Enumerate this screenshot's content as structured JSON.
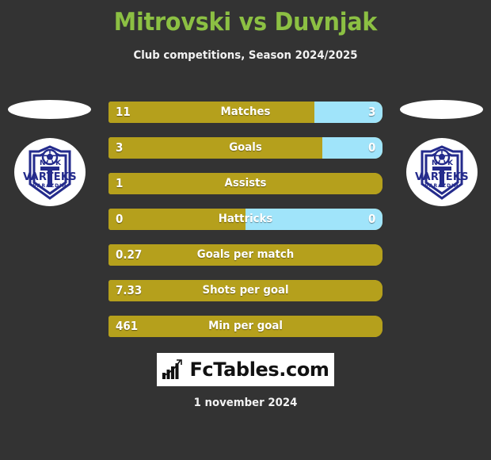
{
  "header": {
    "title": "Mitrovski vs Duvnjak",
    "subtitle": "Club competitions, Season 2024/2025",
    "title_color": "#8CC043"
  },
  "teams": {
    "home": {
      "logo_name": "nk-varteks-varazdin-logo",
      "logo_text_top": "NK",
      "logo_text_main": "VARTEKS",
      "logo_text_bottom": "VARAZDIN"
    },
    "away": {
      "logo_name": "nk-varteks-varazdin-logo",
      "logo_text_top": "NK",
      "logo_text_main": "VARTEKS",
      "logo_text_bottom": "VARAZDIN"
    }
  },
  "colors": {
    "background": "#333333",
    "home_bar": "#B5A01C",
    "away_bar": "#A0E4FA",
    "accent": "#8CC043"
  },
  "chart_data": {
    "type": "bar",
    "title": "Mitrovski vs Duvnjak",
    "subtitle": "Club competitions, Season 2024/2025",
    "orientation": "horizontal-diverging",
    "categories": [
      "Matches",
      "Goals",
      "Assists",
      "Hattricks",
      "Goals per match",
      "Shots per goal",
      "Min per goal"
    ],
    "series": [
      {
        "name": "Mitrovski",
        "values": [
          "11",
          "3",
          "1",
          "0",
          "0.27",
          "7.33",
          "461"
        ]
      },
      {
        "name": "Duvnjak",
        "values": [
          "3",
          "0",
          "",
          "0",
          "",
          "",
          ""
        ]
      }
    ],
    "rows": [
      {
        "label": "Matches",
        "home": "11",
        "away": "3",
        "home_pct": 75,
        "away_pct": 25,
        "show_away": true
      },
      {
        "label": "Goals",
        "home": "3",
        "away": "0",
        "home_pct": 78,
        "away_pct": 22,
        "show_away": true
      },
      {
        "label": "Assists",
        "home": "1",
        "away": "",
        "home_pct": 100,
        "away_pct": 0,
        "show_away": false
      },
      {
        "label": "Hattricks",
        "home": "0",
        "away": "0",
        "home_pct": 50,
        "away_pct": 50,
        "show_away": true
      },
      {
        "label": "Goals per match",
        "home": "0.27",
        "away": "",
        "home_pct": 100,
        "away_pct": 0,
        "show_away": false
      },
      {
        "label": "Shots per goal",
        "home": "7.33",
        "away": "",
        "home_pct": 100,
        "away_pct": 0,
        "show_away": false
      },
      {
        "label": "Min per goal",
        "home": "461",
        "away": "",
        "home_pct": 100,
        "away_pct": 0,
        "show_away": false
      }
    ]
  },
  "footer": {
    "brand_name": "FcTables.com",
    "brand_icon": "bar-chart-growth-icon",
    "date": "1 november 2024"
  }
}
